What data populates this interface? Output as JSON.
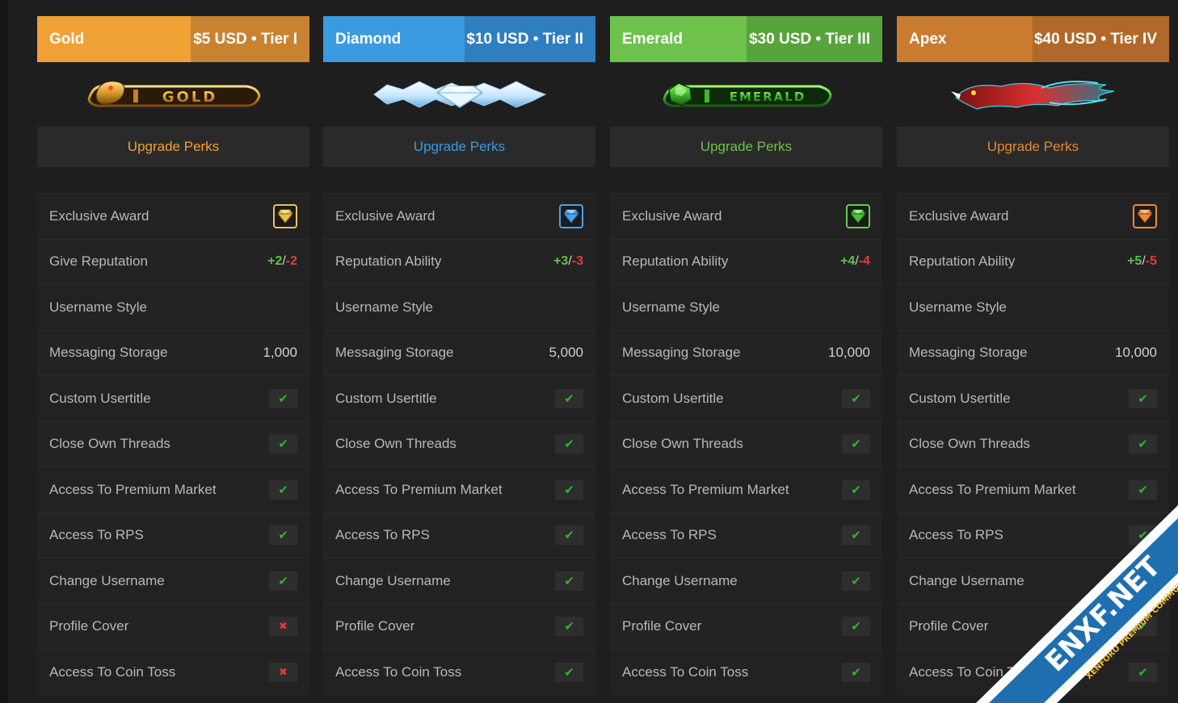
{
  "tiers": [
    {
      "name": "Gold",
      "price": "$5 USD • Tier I",
      "perks_label": "Upgrade Perks",
      "logo_text": "GOLD",
      "rows": {
        "exclusive_award": "Exclusive Award",
        "rep_label": "Give Reputation",
        "rep_plus": "+2",
        "rep_minus": "-2",
        "username_style": "Username Style",
        "messaging_storage": "Messaging Storage",
        "messaging_value": "1,000",
        "custom_usertitle": "Custom Usertitle",
        "close_own_threads": "Close Own Threads",
        "premium_market": "Access To Premium Market",
        "rps": "Access To RPS",
        "change_username": "Change Username",
        "profile_cover": "Profile Cover",
        "coin_toss": "Access To Coin Toss"
      }
    },
    {
      "name": "Diamond",
      "price": "$10 USD • Tier II",
      "perks_label": "Upgrade Perks",
      "logo_text": "",
      "rows": {
        "exclusive_award": "Exclusive Award",
        "rep_label": "Reputation Ability",
        "rep_plus": "+3",
        "rep_minus": "-3",
        "username_style": "Username Style",
        "messaging_storage": "Messaging Storage",
        "messaging_value": "5,000",
        "custom_usertitle": "Custom Usertitle",
        "close_own_threads": "Close Own Threads",
        "premium_market": "Access To Premium Market",
        "rps": "Access To RPS",
        "change_username": "Change Username",
        "profile_cover": "Profile Cover",
        "coin_toss": "Access To Coin Toss"
      }
    },
    {
      "name": "Emerald",
      "price": "$30 USD • Tier III",
      "perks_label": "Upgrade Perks",
      "logo_text": "EMERALD",
      "rows": {
        "exclusive_award": "Exclusive Award",
        "rep_label": "Reputation Ability",
        "rep_plus": "+4",
        "rep_minus": "-4",
        "username_style": "Username Style",
        "messaging_storage": "Messaging Storage",
        "messaging_value": "10,000",
        "custom_usertitle": "Custom Usertitle",
        "close_own_threads": "Close Own Threads",
        "premium_market": "Access To Premium Market",
        "rps": "Access To RPS",
        "change_username": "Change Username",
        "profile_cover": "Profile Cover",
        "coin_toss": "Access To Coin Toss"
      }
    },
    {
      "name": "Apex",
      "price": "$40 USD • Tier IV",
      "perks_label": "Upgrade Perks",
      "logo_text": "",
      "rows": {
        "exclusive_award": "Exclusive Award",
        "rep_label": "Reputation Ability",
        "rep_plus": "+5",
        "rep_minus": "-5",
        "username_style": "Username Style",
        "messaging_storage": "Messaging Storage",
        "messaging_value": "10,000",
        "custom_usertitle": "Custom Usertitle",
        "close_own_threads": "Close Own Threads",
        "premium_market": "Access To Premium Market",
        "rps": "Access To RPS",
        "change_username": "Change Username",
        "profile_cover": "Profile Cover",
        "coin_toss": "Access To Coin Toss"
      }
    }
  ],
  "rep_slash": "/",
  "check_glyph": "✔",
  "cross_glyph": "✖",
  "watermark": {
    "brand": "ENXF.NET",
    "tagline": "XENFORO PREMIUM COMMUNITY"
  },
  "colors": {
    "gold": "#f0a135",
    "diamond": "#3b9be0",
    "emerald": "#6ec24c",
    "apex": "#c97b2f",
    "check": "#2fb52f",
    "cross": "#e03a3a"
  }
}
